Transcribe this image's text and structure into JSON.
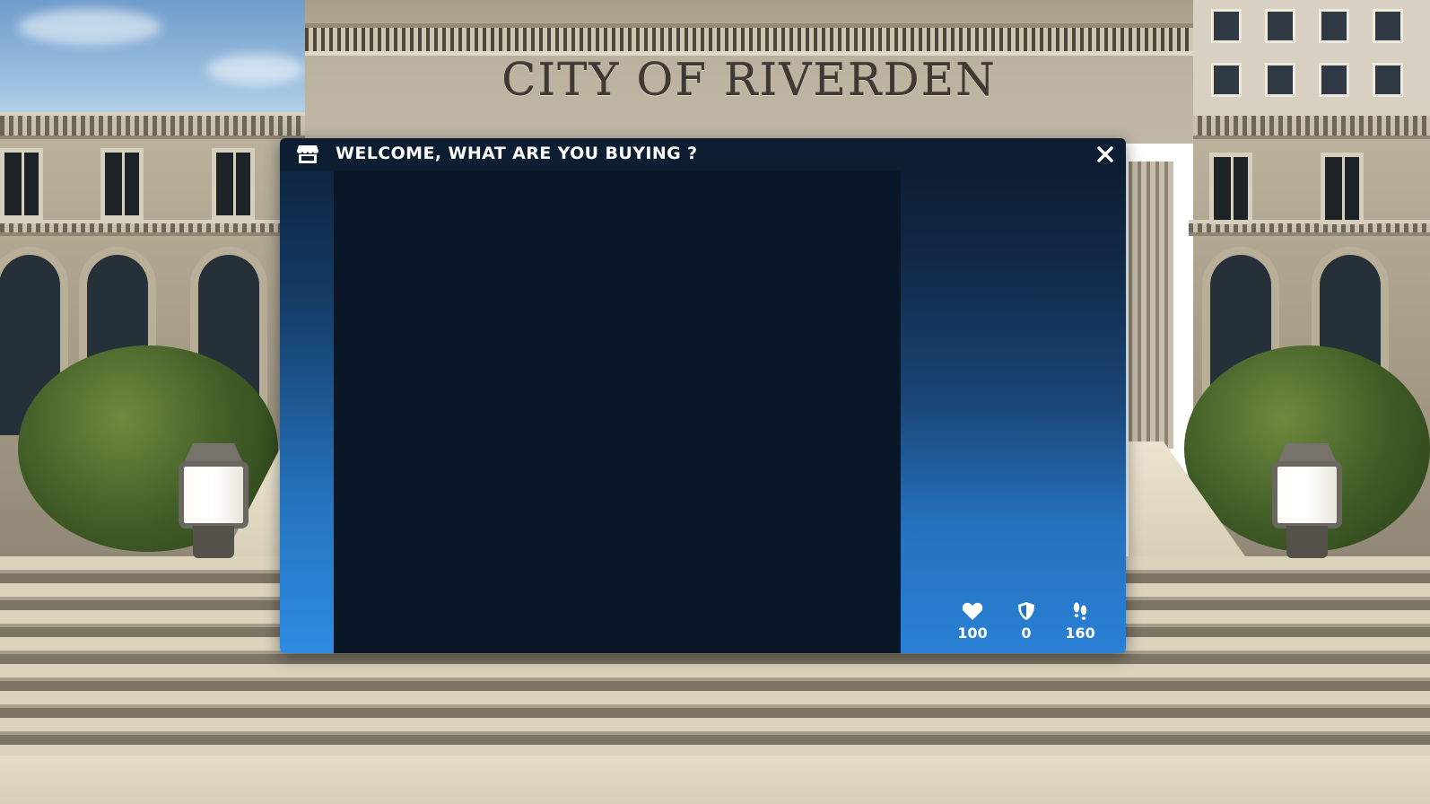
{
  "scene": {
    "building_inscription": "CITY OF RIVERDEN"
  },
  "shop_dialog": {
    "title": "WELCOME, WHAT ARE YOU BUYING ?",
    "title_icon": "shop-icon",
    "close_icon": "close-icon",
    "stats": [
      {
        "icon": "heart-icon",
        "value": "100"
      },
      {
        "icon": "shield-icon",
        "value": "0"
      },
      {
        "icon": "footsteps-icon",
        "value": "160"
      }
    ]
  },
  "colors": {
    "titlebar": "#0d1e33",
    "item_area": "#0a1727",
    "accent_blue": "#2a80d4"
  }
}
